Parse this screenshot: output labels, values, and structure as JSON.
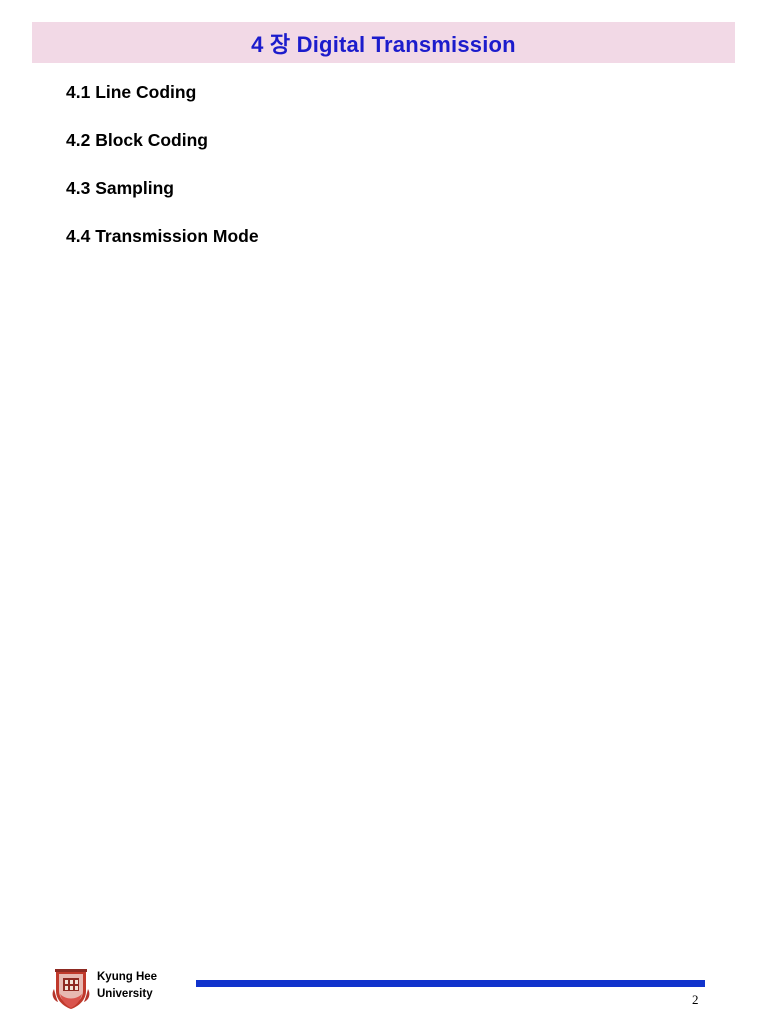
{
  "slide": {
    "title": "4 장 Digital Transmission",
    "title_bg_color": "#f2d9e6",
    "title_text_color": "#1c1ccc",
    "bullets": [
      {
        "label": "4.1 Line Coding"
      },
      {
        "label": "4.2 Block Coding"
      },
      {
        "label": "4.3 Sampling"
      },
      {
        "label": "4.4 Transmission Mode"
      }
    ],
    "footer": {
      "org_line1": "Kyung Hee",
      "org_line2": "University",
      "rule_color": "#1133cc",
      "page_number": "2"
    }
  }
}
